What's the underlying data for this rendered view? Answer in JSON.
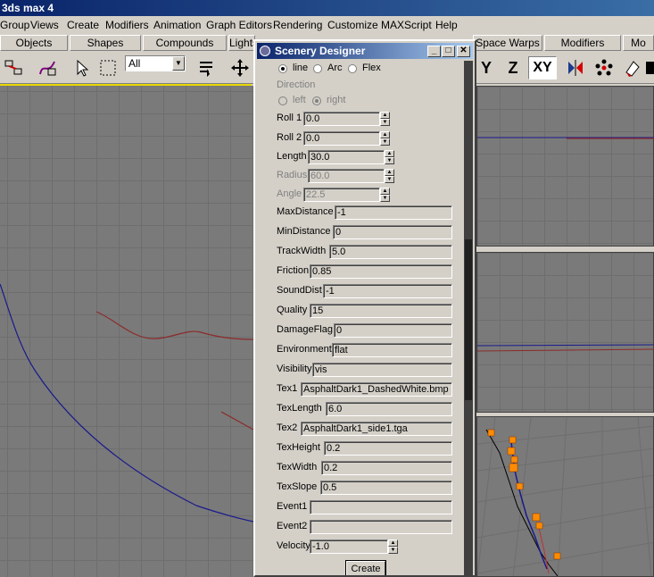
{
  "app": {
    "title": "3ds max 4"
  },
  "menu": [
    "Group",
    "Views",
    "Create",
    "Modifiers",
    "Animation",
    "Graph Editors",
    "Rendering",
    "Customize",
    "MAXScript",
    "Help"
  ],
  "tabs": [
    "Objects",
    "Shapes",
    "Compounds",
    "Lights",
    "Space Warps",
    "Modifiers",
    "Mo"
  ],
  "toolbar": {
    "selection_filter": "All",
    "axis_y": "Y",
    "axis_z": "Z",
    "axis_xy": "XY"
  },
  "dialog": {
    "title": "Scenery Designer",
    "mode": {
      "options": [
        "line",
        "Arc",
        "Flex"
      ],
      "selected": "line"
    },
    "direction": {
      "label": "Direction",
      "options": [
        "left",
        "right"
      ],
      "selected": "right"
    },
    "spinners": [
      {
        "label": "Roll 1",
        "value": "0.0",
        "enabled": true
      },
      {
        "label": "Roll 2",
        "value": "0.0",
        "enabled": true
      },
      {
        "label": "Length",
        "value": "30.0",
        "enabled": true
      },
      {
        "label": "Radius",
        "value": "60.0",
        "enabled": false
      },
      {
        "label": "Angle",
        "value": "22.5",
        "enabled": false
      }
    ],
    "fields": [
      {
        "label": "MaxDistance",
        "value": "-1"
      },
      {
        "label": "MinDistance",
        "value": "0"
      },
      {
        "label": "TrackWidth",
        "value": "5.0"
      },
      {
        "label": "Friction",
        "value": "0.85"
      },
      {
        "label": "SoundDist",
        "value": "-1"
      },
      {
        "label": "Quality",
        "value": "15"
      },
      {
        "label": "DamageFlag",
        "value": "0"
      },
      {
        "label": "Environment",
        "value": "flat"
      },
      {
        "label": "Visibility",
        "value": "vis"
      },
      {
        "label": "Tex1",
        "value": "AsphaltDark1_DashedWhite.bmp"
      },
      {
        "label": "TexLength",
        "value": "6.0"
      },
      {
        "label": "Tex2",
        "value": "AsphaltDark1_side1.tga"
      },
      {
        "label": "TexHeight",
        "value": "0.2"
      },
      {
        "label": "TexWidth",
        "value": "0.2"
      },
      {
        "label": "TexSlope",
        "value": "0.5"
      },
      {
        "label": "Event1",
        "value": ""
      },
      {
        "label": "Event2",
        "value": ""
      }
    ],
    "velocity": {
      "label": "Velocity",
      "value": "-1.0"
    },
    "create_label": "Create"
  },
  "colors": {
    "title_bar": "#0a246a",
    "viewport_bg": "#7a7a7a",
    "track_blue": "#1a1a8c",
    "track_red": "#8c2a2a",
    "marker_orange": "#ff8c00"
  }
}
